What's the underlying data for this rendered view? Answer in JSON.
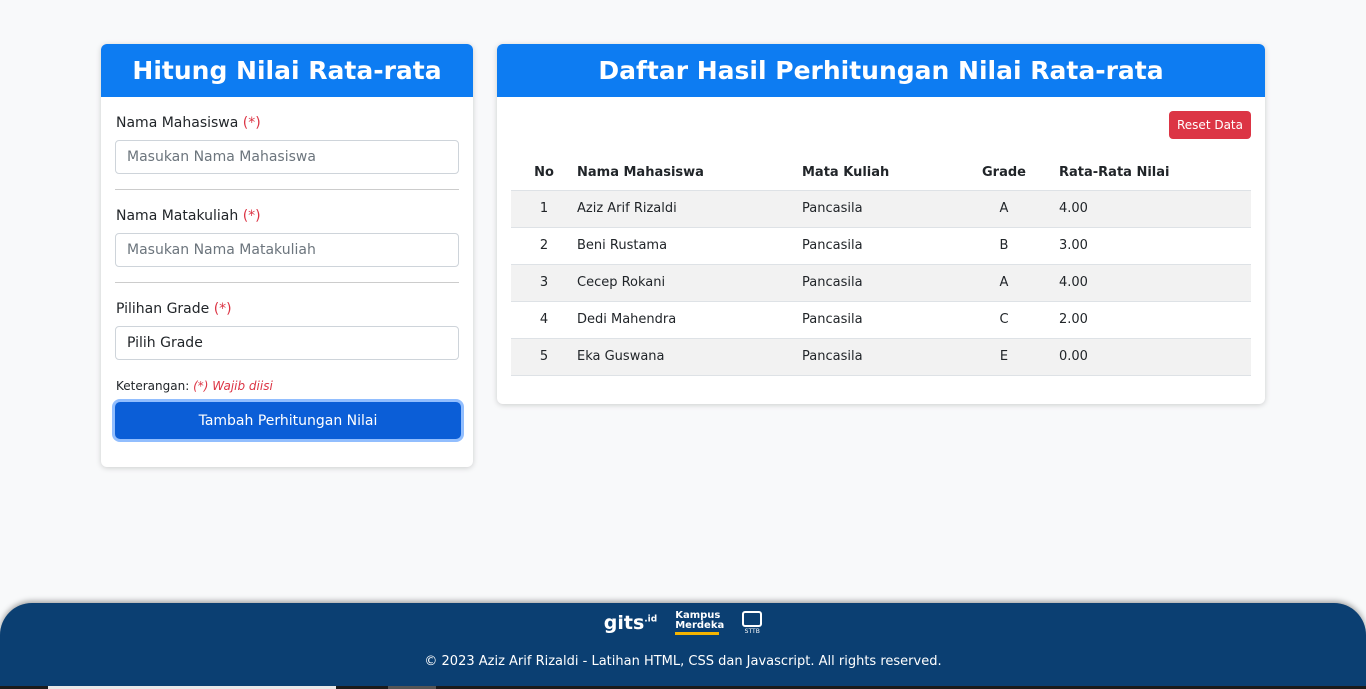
{
  "form": {
    "title": "Hitung Nilai Rata-rata",
    "fields": [
      {
        "label": "Nama Mahasiswa",
        "required": "(*)",
        "placeholder": "Masukan Nama Mahasiswa"
      },
      {
        "label": "Nama Matakuliah",
        "required": "(*)",
        "placeholder": "Masukan Nama Matakuliah"
      },
      {
        "label": "Pilihan Grade",
        "required": "(*)",
        "selected": "Pilih Grade"
      }
    ],
    "note_label": "Keterangan:",
    "note_value": "(*) Wajib diisi",
    "submit_label": "Tambah Perhitungan Nilai"
  },
  "results": {
    "title": "Daftar Hasil Perhitungan Nilai Rata-rata",
    "reset_label": "Reset Data",
    "columns": [
      "No",
      "Nama Mahasiswa",
      "Mata Kuliah",
      "Grade",
      "Rata-Rata Nilai"
    ],
    "rows": [
      [
        "1",
        "Aziz Arif Rizaldi",
        "Pancasila",
        "A",
        "4.00"
      ],
      [
        "2",
        "Beni Rustama",
        "Pancasila",
        "B",
        "3.00"
      ],
      [
        "3",
        "Cecep Rokani",
        "Pancasila",
        "A",
        "4.00"
      ],
      [
        "4",
        "Dedi Mahendra",
        "Pancasila",
        "C",
        "2.00"
      ],
      [
        "5",
        "Eka Guswana",
        "Pancasila",
        "E",
        "0.00"
      ]
    ]
  },
  "footer": {
    "logos": {
      "gits": "gits",
      "gits_sup": ".id",
      "km_line1": "Kampus",
      "km_line2": "Merdeka",
      "sttb": "STTB"
    },
    "copyright": "© 2023 Aziz Arif Rizaldi - Latihan HTML, CSS dan Javascript. All rights reserved."
  },
  "colors": {
    "primary": "#0d7cf2",
    "danger": "#dc3545",
    "footer": "#0b3f72"
  }
}
